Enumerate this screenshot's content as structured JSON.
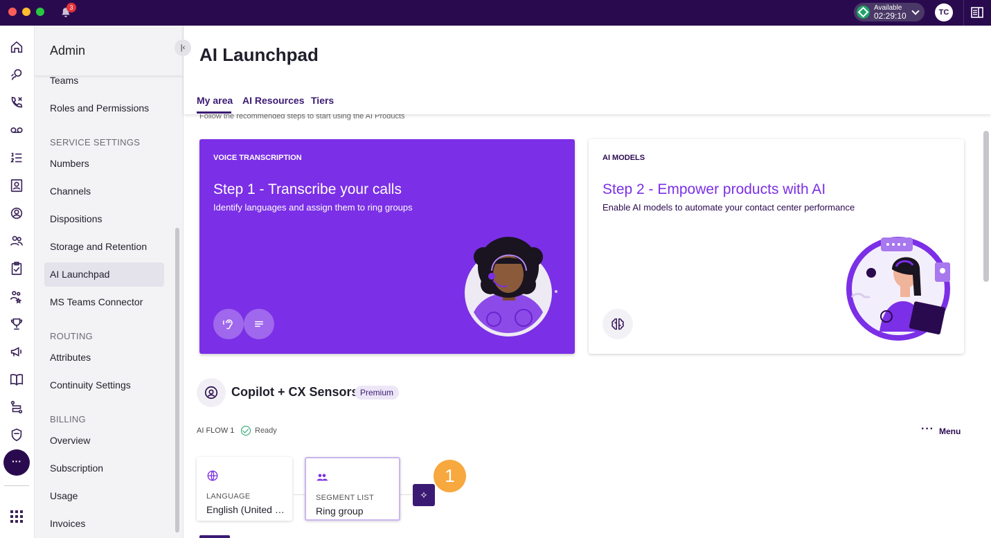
{
  "titlebar": {
    "notification_count": "3",
    "status_label": "Available",
    "status_timer": "02:29:10",
    "user_initials": "TC"
  },
  "rail": {
    "icons": [
      "home-icon",
      "conversations-icon",
      "calls-icon",
      "voicemail-icon",
      "queue-icon",
      "contacts-icon",
      "agent-icon",
      "team-icon",
      "tasks-icon",
      "skills-icon",
      "trophy-icon",
      "campaigns-icon",
      "knowledge-icon",
      "flows-icon",
      "shield-icon",
      "more-icon",
      "apps-grid-icon"
    ],
    "more_label": "···"
  },
  "sidebar": {
    "title": "Admin",
    "items": {
      "teams": "Teams",
      "roles": "Roles and Permissions",
      "service_heading": "SERVICE SETTINGS",
      "numbers": "Numbers",
      "channels": "Channels",
      "dispositions": "Dispositions",
      "storage": "Storage and Retention",
      "ai_launchpad": "AI Launchpad",
      "ms_teams": "MS Teams Connector",
      "routing_heading": "ROUTING",
      "attributes": "Attributes",
      "continuity": "Continuity Settings",
      "billing_heading": "BILLING",
      "overview": "Overview",
      "subscription": "Subscription",
      "usage": "Usage",
      "invoices": "Invoices"
    }
  },
  "main": {
    "title": "AI Launchpad",
    "tabs": [
      "My area",
      "AI Resources",
      "Tiers"
    ],
    "active_tab": "My area",
    "subtitle": "Follow the recommended steps to start using the AI Products",
    "cards": {
      "voice": {
        "kicker": "VOICE TRANSCRIPTION",
        "heading": "Step 1 - Transcribe your calls",
        "description": "Identify languages and assign them to ring groups"
      },
      "ai": {
        "kicker": "AI MODELS",
        "heading": "Step 2 - Empower products with AI",
        "description": "Enable AI models to automate your contact center performance"
      }
    },
    "copilot": {
      "title": "Copilot + CX Sensors",
      "badge": "Premium",
      "flow_label": "AI FLOW 1",
      "flow_status": "Ready",
      "menu_label": "Menu",
      "nodes": [
        {
          "label": "LANGUAGE",
          "value": "English (United States)"
        },
        {
          "label": "SEGMENT LIST",
          "value": "Ring group"
        }
      ],
      "step_number": "1"
    }
  },
  "colors": {
    "brand_dark": "#2a0a4f",
    "brand_purple": "#7b2fe6",
    "status_green": "#1fa36a",
    "step_orange": "#f7a83e"
  }
}
